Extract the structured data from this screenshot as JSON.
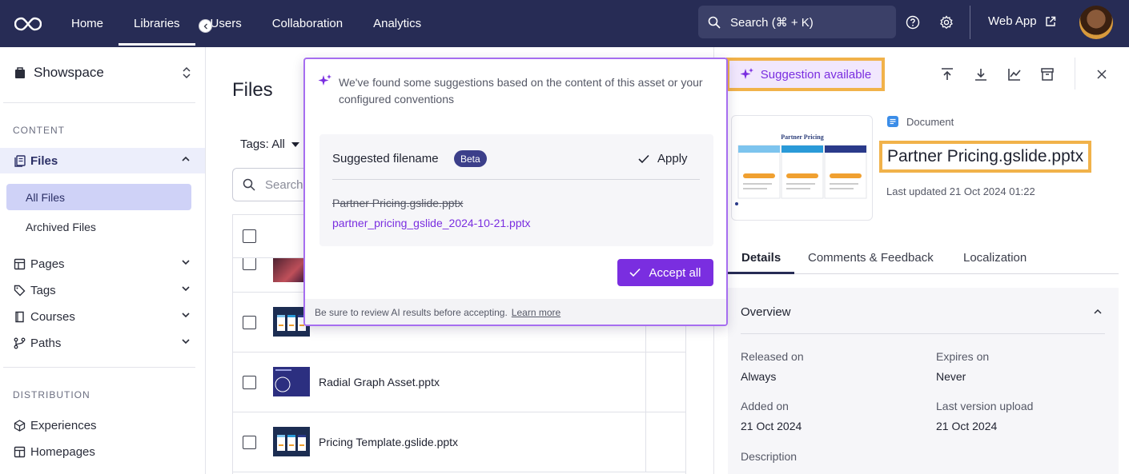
{
  "nav": {
    "items": [
      "Home",
      "Libraries",
      "Users",
      "Collaboration",
      "Analytics"
    ],
    "active": "Libraries",
    "search_label": "Search (⌘ + K)",
    "web_app_label": "Web App"
  },
  "sidebar": {
    "workspace": "Showspace",
    "content_heading": "CONTENT",
    "files_label": "Files",
    "all_files": "All Files",
    "archived_files": "Archived Files",
    "pages": "Pages",
    "tags": "Tags",
    "courses": "Courses",
    "paths": "Paths",
    "distribution_heading": "DISTRIBUTION",
    "experiences": "Experiences",
    "homepages": "Homepages"
  },
  "main": {
    "title": "Files",
    "tags_filter": "Tags: All",
    "search_placeholder": "Search",
    "rows": [
      "Radial Graph Asset.pptx",
      "Pricing Template.gslide.pptx"
    ]
  },
  "popover": {
    "intro": "We've found some suggestions based on the content of this asset or your configured conventions",
    "suggested_heading": "Suggested filename",
    "beta": "Beta",
    "apply": "Apply",
    "old_name": "Partner Pricing.gslide.pptx",
    "new_name": "partner_pricing_gslide_2024-10-21.pptx",
    "accept_all": "Accept all",
    "footer": "Be sure to review AI results before accepting.",
    "learn_more": "Learn more"
  },
  "detail": {
    "suggestion_btn": "Suggestion available",
    "doc_type": "Document",
    "title": "Partner Pricing.gslide.pptx",
    "last_updated": "Last updated 21 Oct 2024 01:22",
    "preview_title": "Partner Pricing",
    "tabs": [
      "Details",
      "Comments & Feedback",
      "Localization"
    ],
    "overview_title": "Overview",
    "fields": {
      "released_label": "Released on",
      "released_value": "Always",
      "expires_label": "Expires on",
      "expires_value": "Never",
      "added_label": "Added on",
      "added_value": "21 Oct 2024",
      "last_upload_label": "Last version upload",
      "last_upload_value": "21 Oct 2024",
      "description_label": "Description"
    }
  },
  "colors": {
    "nav_bg": "#272c55",
    "accent": "#7a2ee0",
    "highlight": "#f1b24a"
  }
}
